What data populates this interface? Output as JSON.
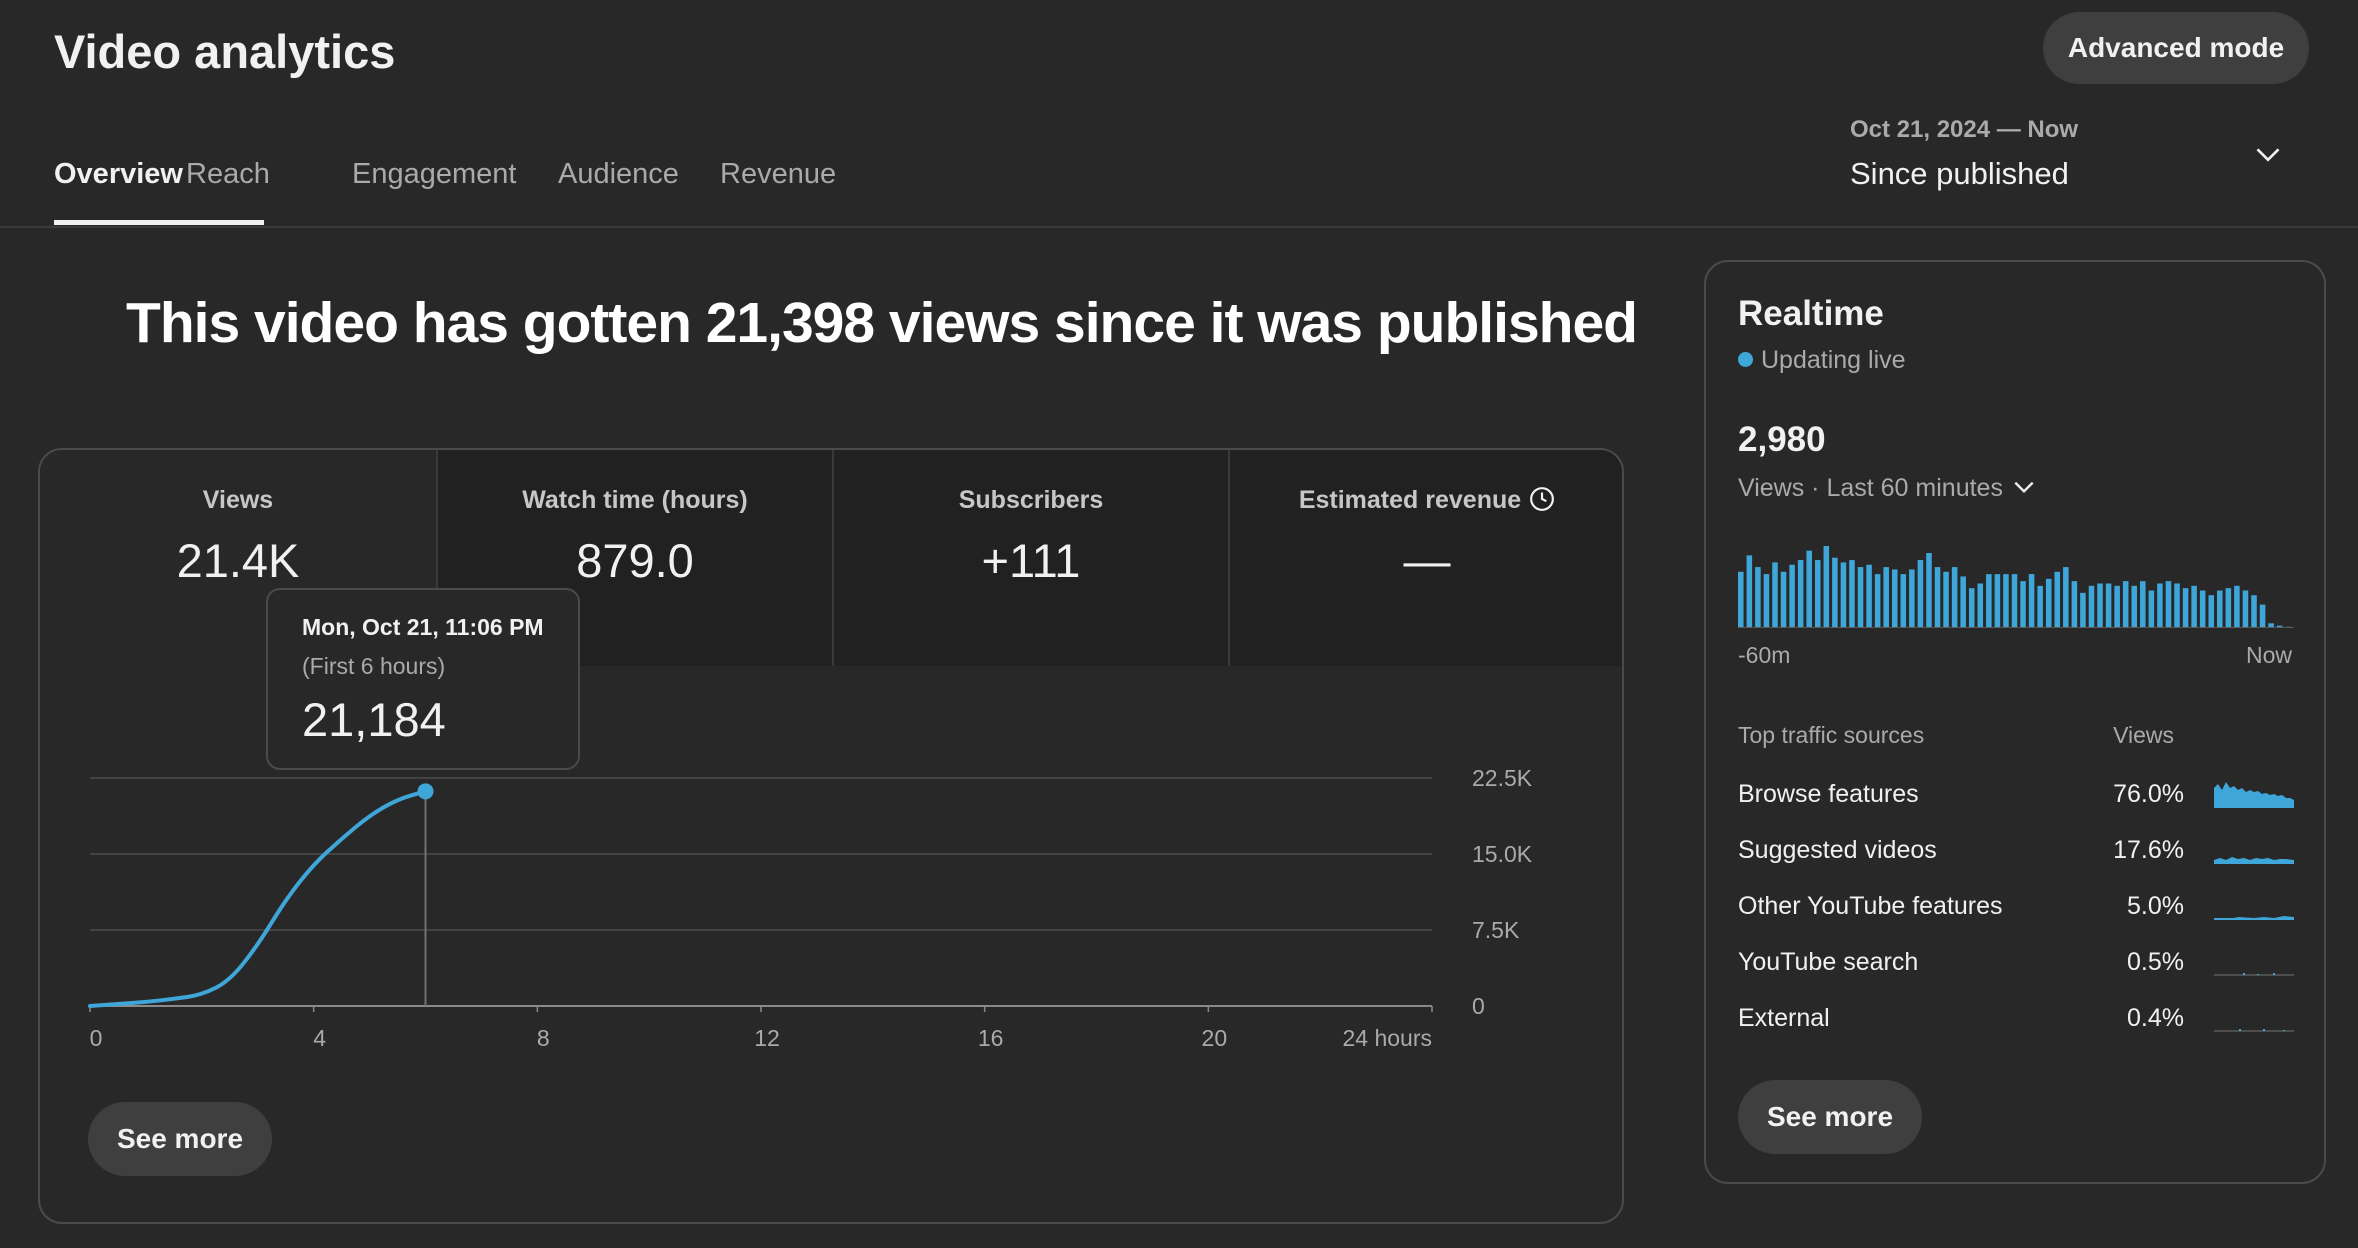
{
  "header": {
    "title": "Video analytics",
    "advanced_mode_label": "Advanced mode",
    "tabs": [
      {
        "label": "Overview",
        "active": true
      },
      {
        "label": "Reach",
        "active": false
      },
      {
        "label": "Engagement",
        "active": false
      },
      {
        "label": "Audience",
        "active": false
      },
      {
        "label": "Revenue",
        "active": false
      }
    ],
    "date_range": {
      "range": "Oct 21, 2024 — Now",
      "label": "Since published",
      "icon": "chevron-down-icon"
    }
  },
  "headline": "This video has gotten 21,398 views since it was published",
  "metrics": [
    {
      "label": "Views",
      "value": "21.4K"
    },
    {
      "label": "Watch time (hours)",
      "value": "879.0"
    },
    {
      "label": "Subscribers",
      "value": "+111"
    },
    {
      "label": "Estimated revenue",
      "value": "—",
      "icon": "clock-icon"
    }
  ],
  "tooltip": {
    "date": "Mon, Oct 21, 11:06 PM",
    "note": "(First 6 hours)",
    "value": "21,184"
  },
  "see_more_label": "See more",
  "chart_data": {
    "type": "line",
    "x": [
      0,
      0.5,
      1,
      1.5,
      2,
      2.5,
      3,
      3.5,
      4,
      4.5,
      5,
      5.5,
      6
    ],
    "series": [
      {
        "values": [
          0,
          200,
          400,
          700,
          1100,
          2500,
          6000,
          10500,
          14000,
          16500,
          18800,
          20400,
          21184
        ]
      }
    ],
    "xticks": [
      "0",
      "4",
      "8",
      "12",
      "16",
      "20",
      "24 hours"
    ],
    "xtick_values": [
      0,
      4,
      8,
      12,
      16,
      20,
      24
    ],
    "yticks": [
      "0",
      "7.5K",
      "15.0K",
      "22.5K"
    ],
    "ytick_values": [
      0,
      7500,
      15000,
      22500
    ],
    "xlim": [
      0,
      24
    ],
    "ylim": [
      0,
      22500
    ],
    "grid": true,
    "highlight_x": 6,
    "colors": {
      "line": "#3ea6d9",
      "grid": "#4a4a4a",
      "cursor": "#717171"
    }
  },
  "realtime": {
    "title": "Realtime",
    "live_label": "Updating live",
    "count": "2,980",
    "views_label": "Views · Last 60 minutes",
    "axis_left": "-60m",
    "axis_right": "Now",
    "minute_views": [
      48,
      62,
      52,
      46,
      56,
      48,
      54,
      58,
      66,
      58,
      70,
      60,
      56,
      58,
      52,
      54,
      46,
      52,
      50,
      46,
      50,
      58,
      64,
      52,
      48,
      52,
      44,
      34,
      38,
      46,
      46,
      46,
      46,
      40,
      46,
      36,
      42,
      48,
      52,
      40,
      30,
      36,
      38,
      38,
      36,
      40,
      36,
      40,
      32,
      38,
      40,
      38,
      34,
      36,
      32,
      28,
      32,
      34,
      36,
      32,
      28,
      20,
      4,
      2,
      1
    ],
    "bar_color": "#3ea6d9",
    "traffic_header": {
      "source": "Top traffic sources",
      "views": "Views"
    },
    "traffic_sources": [
      {
        "name": "Browse features",
        "pct": "76.0%"
      },
      {
        "name": "Suggested videos",
        "pct": "17.6%"
      },
      {
        "name": "Other YouTube features",
        "pct": "5.0%"
      },
      {
        "name": "YouTube search",
        "pct": "0.5%"
      },
      {
        "name": "External",
        "pct": "0.4%"
      }
    ],
    "see_more_label": "See more"
  }
}
